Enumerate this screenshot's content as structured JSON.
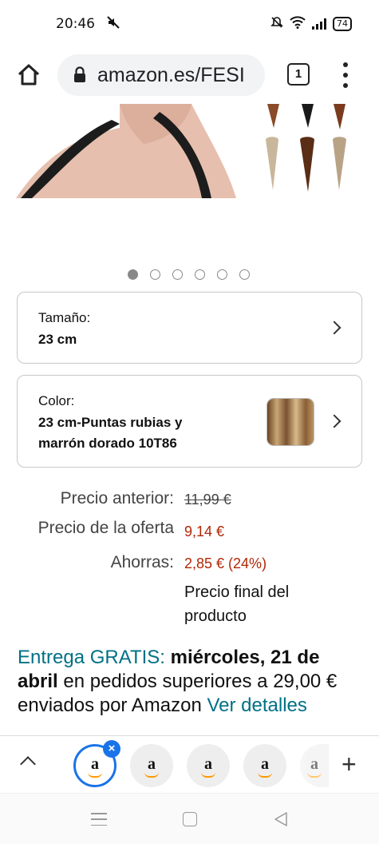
{
  "status_bar": {
    "time": "20:46",
    "battery": "74"
  },
  "browser": {
    "url": "amazon.es/FESI",
    "tab_count": "1"
  },
  "gallery": {
    "image_count": 6,
    "active_index": 0
  },
  "size_option": {
    "label": "Tamaño:",
    "value": "23 cm"
  },
  "color_option": {
    "label": "Color:",
    "value_line1": "23 cm-Puntas rubias y",
    "value_line2": "marrón dorado 10T86"
  },
  "pricing": {
    "previous_label": "Precio anterior:",
    "previous_value": "11,99 €",
    "offer_label": "Precio de la oferta",
    "offer_value": "9,14 €",
    "savings_label": "Ahorras:",
    "savings_value": "2,85 € (24%)",
    "final_note_line1": "Precio final del",
    "final_note_line2": "producto"
  },
  "delivery": {
    "free_label": "Entrega GRATIS:",
    "date_part1": "miércoles, 21 de",
    "date_part2": "abril",
    "condition": "en pedidos superiores a 29,00 € enviados por Amazon",
    "details_link": "Ver detalles"
  },
  "tab_strip": {
    "tabs": [
      "a",
      "a",
      "a",
      "a",
      "a"
    ]
  },
  "colors": {
    "price_red": "#b12704",
    "link_teal": "#007185",
    "active_tab_blue": "#1a73e8"
  }
}
